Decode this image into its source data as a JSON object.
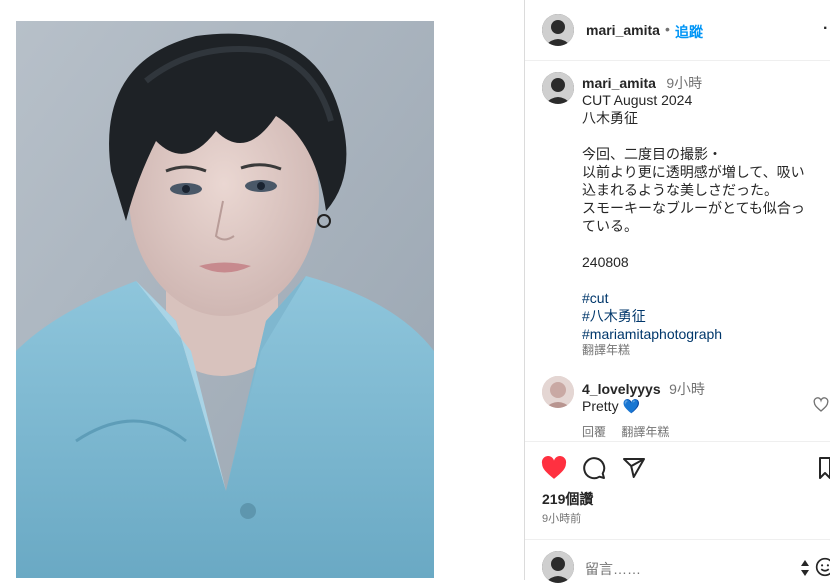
{
  "header": {
    "username": "mari_amita",
    "separator": "•",
    "follow_label": "追蹤",
    "more_icon": "more-dots-icon"
  },
  "caption": {
    "username": "mari_amita",
    "time": "9小時",
    "lines": [
      "CUT August 2024",
      "八木勇征",
      "今回、二度目の撮影・",
      "以前より更に透明感が増して、吸い",
      "込まれるような美しさだった。",
      "スモーキーなブルーがとても似合っ",
      "ている。",
      "240808"
    ],
    "hashtags": [
      "#cut",
      "#八木勇征",
      "#mariamitaphotograph"
    ],
    "translate_label": "翻譯年糕"
  },
  "comment": {
    "username": "4_lovelyyys",
    "time": "9小時",
    "text": "Pretty",
    "emoji": "💙",
    "reply_label": "回覆",
    "translate_label": "翻譯年糕"
  },
  "actions": {
    "like_icon": "heart-filled-icon",
    "comment_icon": "comment-icon",
    "share_icon": "share-icon",
    "save_icon": "bookmark-icon",
    "like_color": "#ff3040"
  },
  "stats": {
    "likes": "219個讚",
    "posted": "9小時前"
  },
  "composer": {
    "placeholder": "留言……"
  }
}
